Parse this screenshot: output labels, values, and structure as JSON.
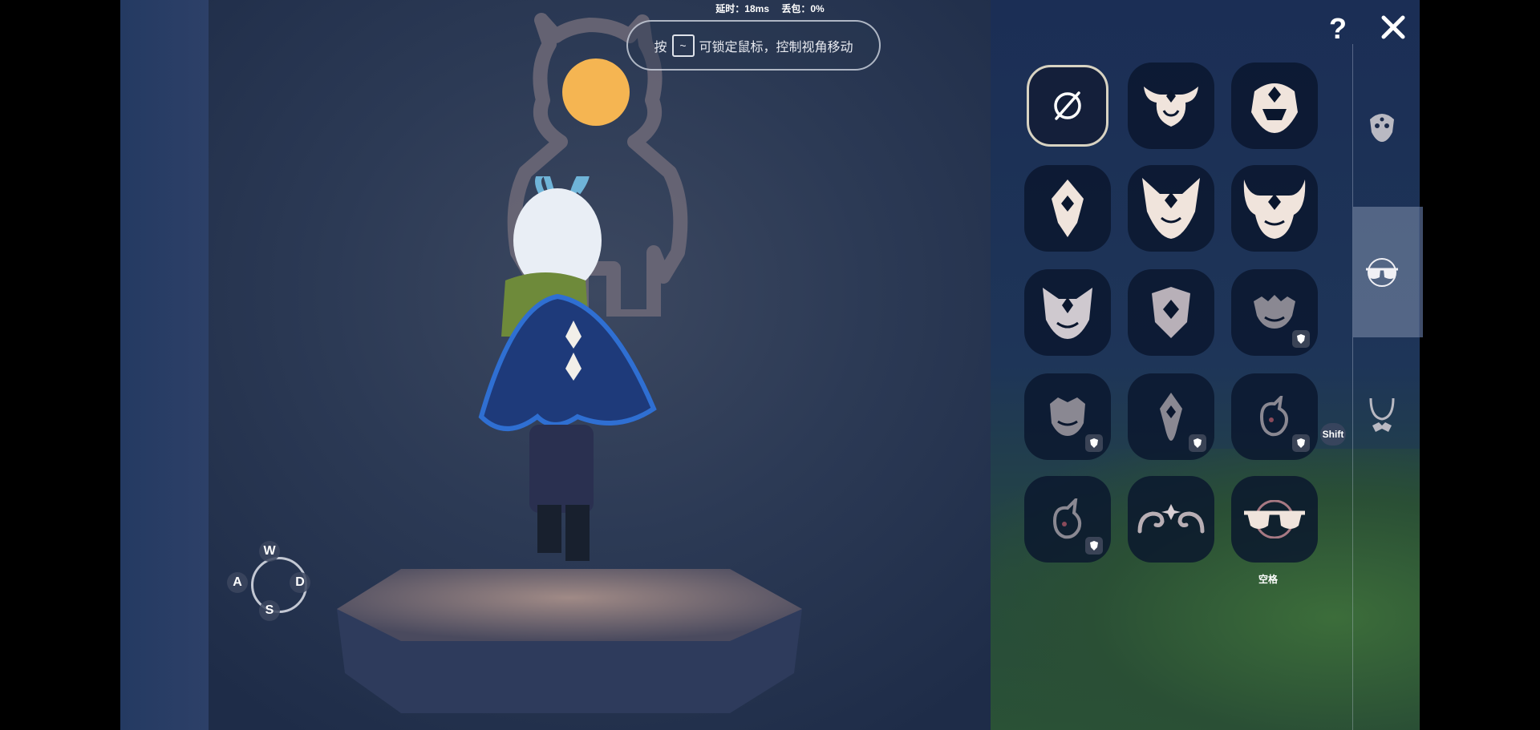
{
  "status": {
    "latency": "延时：18ms",
    "packet_loss": "丢包：0%"
  },
  "hint": {
    "prefix": "按",
    "key": "~",
    "text": "可锁定鼠标，控制视角移动"
  },
  "controls": {
    "w": "W",
    "a": "A",
    "s": "S",
    "d": "D"
  },
  "panel": {
    "help_label": "?",
    "shortcut_shift": "Shift",
    "shortcut_space": "空格",
    "categories": [
      {
        "icon": "face-mask-icon",
        "active": false
      },
      {
        "icon": "glasses-icon",
        "active": true
      },
      {
        "icon": "necklace-icon",
        "active": false
      }
    ],
    "items": [
      {
        "icon": "none-slot-icon",
        "selected": true,
        "locked": false
      },
      {
        "icon": "horned-mask-icon",
        "selected": false,
        "locked": false
      },
      {
        "icon": "helmet-mask-icon",
        "selected": false,
        "locked": false
      },
      {
        "icon": "diamond-mask-icon",
        "selected": false,
        "locked": false
      },
      {
        "icon": "fox-mask-icon",
        "selected": false,
        "locked": false
      },
      {
        "icon": "ox-mask-icon",
        "selected": false,
        "locked": false
      },
      {
        "icon": "cat-mask-icon",
        "selected": false,
        "locked": false
      },
      {
        "icon": "shield-mask-icon",
        "selected": false,
        "locked": false
      },
      {
        "icon": "crown-mask-icon",
        "selected": false,
        "locked": true
      },
      {
        "icon": "oni-mask-icon",
        "selected": false,
        "locked": true
      },
      {
        "icon": "gem-mask-icon",
        "selected": false,
        "locked": true
      },
      {
        "icon": "moth-mask-icon",
        "selected": false,
        "locked": true
      },
      {
        "icon": "leaf-mask-icon",
        "selected": false,
        "locked": true
      },
      {
        "icon": "swirl-brow-icon",
        "selected": false,
        "locked": false
      },
      {
        "icon": "pink-glasses-icon",
        "selected": false,
        "locked": false
      }
    ]
  },
  "colors": {
    "mask_fill": "#f0e4dc",
    "mask_dark": "#f2e6de",
    "lock_bg": "#3a4356",
    "accent_pink": "#e8a0a8"
  }
}
